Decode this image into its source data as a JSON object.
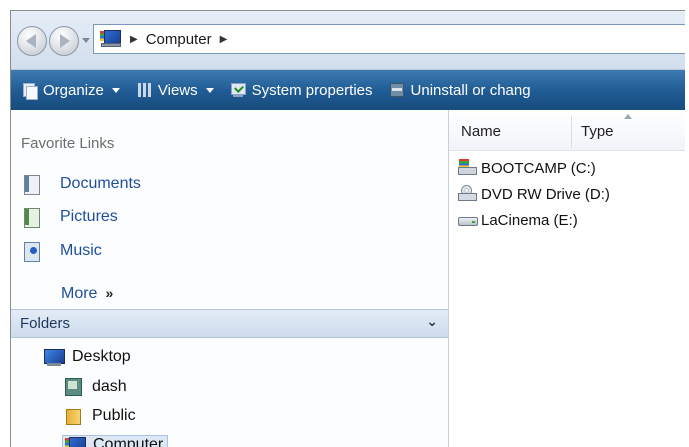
{
  "address_bar": {
    "path": [
      "Computer"
    ]
  },
  "toolbar": {
    "organize": "Organize",
    "views": "Views",
    "system_properties": "System properties",
    "uninstall": "Uninstall or chang"
  },
  "favorites": {
    "title": "Favorite Links",
    "items": [
      {
        "label": "Documents",
        "icon": "documents-icon"
      },
      {
        "label": "Pictures",
        "icon": "pictures-icon"
      },
      {
        "label": "Music",
        "icon": "music-icon"
      }
    ],
    "more_label": "More",
    "more_chevron": "»"
  },
  "folders": {
    "label": "Folders",
    "chevron": "⌄",
    "tree": [
      {
        "label": "Desktop"
      },
      {
        "label": "dash"
      },
      {
        "label": "Public"
      },
      {
        "label": "Computer"
      }
    ]
  },
  "columns": {
    "name": "Name",
    "type": "Type"
  },
  "drives": [
    {
      "label": "BOOTCAMP (C:)"
    },
    {
      "label": "DVD RW Drive (D:)"
    },
    {
      "label": "LaCinema (E:)"
    }
  ],
  "colors": {
    "toolbar": "#1f5a92",
    "link": "#1f4f9c",
    "folders_bar": "#d5e1ef"
  }
}
